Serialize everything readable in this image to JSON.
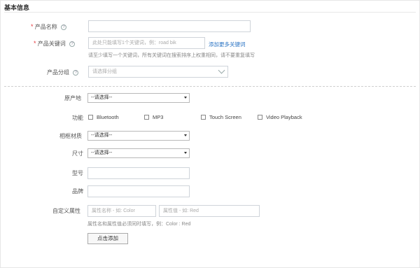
{
  "section": {
    "title": "基本信息"
  },
  "basic": {
    "product_name": {
      "required": "*",
      "label": "产品名称",
      "help": "?",
      "value": ""
    },
    "keywords": {
      "required": "*",
      "label": "产品关键词",
      "help": "?",
      "placeholder": "此处只能填写1个关键词，例：road bik",
      "add_more": "添加更多关键词",
      "hint": "请至少填写一个关键词，所有关键词在搜索排序上权重相同，请不要重复填写"
    },
    "category": {
      "label": "产品分组",
      "help": "?",
      "placeholder": "请选择分组"
    }
  },
  "attributes": {
    "origin": {
      "label": "原产地",
      "selected": "--请选择--"
    },
    "features": {
      "label": "功能",
      "options": [
        "Bluetooth",
        "MP3",
        "Touch Screen",
        "Video Playback"
      ]
    },
    "frame_material": {
      "label": "相框材质",
      "selected": "--请选择--"
    },
    "size": {
      "label": "尺寸",
      "selected": "--请选择--"
    },
    "model": {
      "label": "型号",
      "value": ""
    },
    "brand": {
      "label": "品牌",
      "value": ""
    },
    "custom": {
      "label": "自定义属性",
      "name_placeholder": "属性名称 - 如: Color",
      "value_placeholder": "属性值 - 如: Red",
      "hint": "属性名和属性值必须同时填写，例：Color : Red",
      "add_button": "点击添加"
    }
  }
}
